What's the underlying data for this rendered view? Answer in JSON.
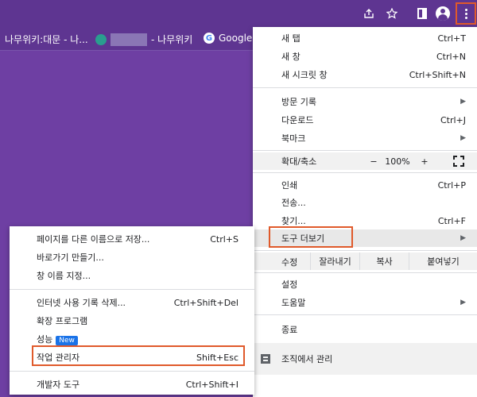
{
  "toolbar": {
    "icons": [
      "share-icon",
      "star-icon",
      "side-panel-icon",
      "profile-icon",
      "kebab-menu-icon"
    ]
  },
  "bookmarks": {
    "items": [
      {
        "label": "나무위키:대문 - 나...",
        "icon": "namuwiki-icon"
      },
      {
        "label": "- 나무위키",
        "icon": "green-circle-icon"
      },
      {
        "label": "Google",
        "icon": "google-icon"
      }
    ]
  },
  "main_menu": {
    "items": [
      {
        "label": "새 탭",
        "shortcut": "Ctrl+T"
      },
      {
        "label": "새 창",
        "shortcut": "Ctrl+N"
      },
      {
        "label": "새 시크릿 창",
        "shortcut": "Ctrl+Shift+N"
      },
      {
        "label": "방문 기록",
        "shortcut": ""
      },
      {
        "label": "다운로드",
        "shortcut": "Ctrl+J"
      },
      {
        "label": "북마크",
        "shortcut": ""
      },
      {
        "label": "인쇄",
        "shortcut": "Ctrl+P"
      },
      {
        "label": "전송...",
        "shortcut": ""
      },
      {
        "label": "찾기...",
        "shortcut": "Ctrl+F"
      },
      {
        "label": "도구 더보기",
        "shortcut": ""
      },
      {
        "label": "설정",
        "shortcut": ""
      },
      {
        "label": "도움말",
        "shortcut": ""
      },
      {
        "label": "종료",
        "shortcut": ""
      }
    ],
    "zoom": {
      "label": "확대/축소",
      "minus": "−",
      "value": "100%",
      "plus": "+"
    },
    "edit": {
      "label": "수정",
      "cut": "잘라내기",
      "copy": "복사",
      "paste": "붙여넣기"
    },
    "managed": {
      "label": "조직에서 관리"
    }
  },
  "sub_menu": {
    "items": [
      {
        "label": "페이지를 다른 이름으로 저장...",
        "shortcut": "Ctrl+S"
      },
      {
        "label": "바로가기 만들기...",
        "shortcut": ""
      },
      {
        "label": "창 이름 지정...",
        "shortcut": ""
      },
      {
        "label": "인터넷 사용 기록 삭제...",
        "shortcut": "Ctrl+Shift+Del"
      },
      {
        "label": "확장 프로그램",
        "shortcut": ""
      },
      {
        "label": "성능",
        "shortcut": "",
        "badge": "New"
      },
      {
        "label": "작업 관리자",
        "shortcut": "Shift+Esc"
      },
      {
        "label": "개발자 도구",
        "shortcut": "Ctrl+Shift+I"
      }
    ]
  },
  "colors": {
    "background": "#6e3fa3",
    "highlight_border": "#e05a2b",
    "badge": "#1a73e8"
  }
}
